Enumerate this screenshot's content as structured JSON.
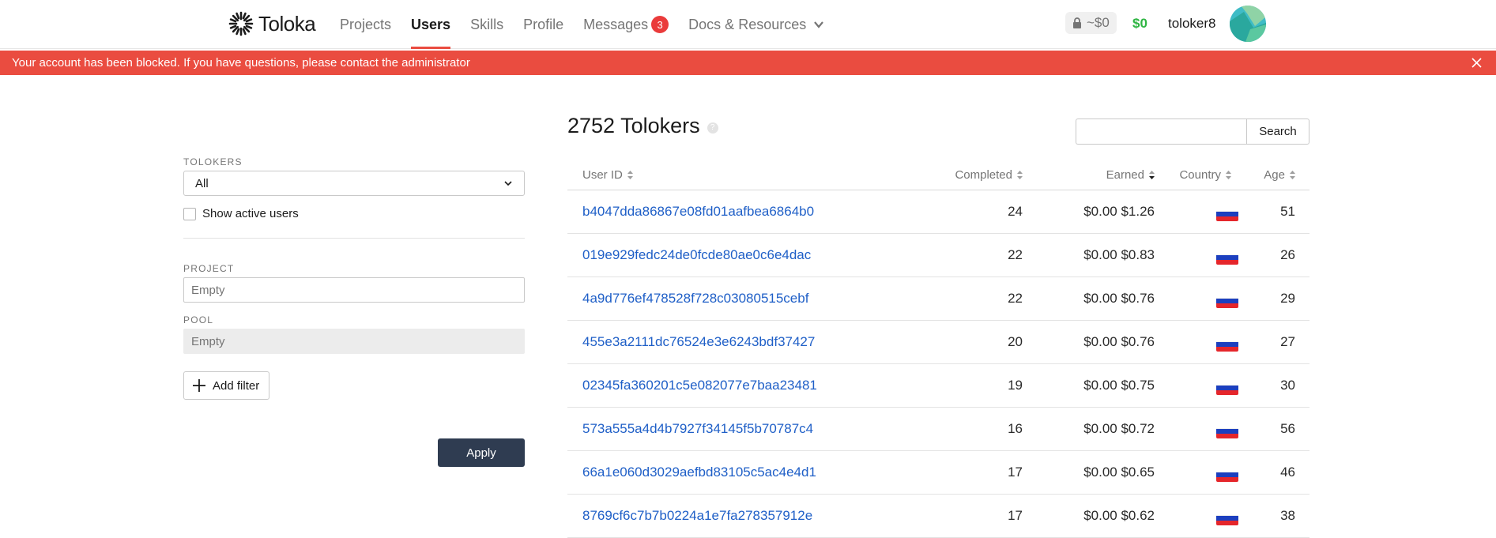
{
  "header": {
    "logo_text": "Toloka",
    "nav": [
      {
        "label": "Projects",
        "active": false
      },
      {
        "label": "Users",
        "active": true
      },
      {
        "label": "Skills",
        "active": false
      },
      {
        "label": "Profile",
        "active": false
      },
      {
        "label": "Messages",
        "active": false,
        "badge": "3"
      },
      {
        "label": "Docs & Resources",
        "active": false
      }
    ],
    "on_hold": "~$0",
    "balance": "$0",
    "username": "toloker8",
    "accent_color": "#ea4c40"
  },
  "alert": {
    "text": "Your account has been blocked. If you have questions, please contact the administrator",
    "color": "#ea4c40"
  },
  "filters": {
    "tolokers_label": "TOLOKERS",
    "tolokers_value": "All",
    "show_active_label": "Show active users",
    "project_label": "PROJECT",
    "project_placeholder": "Empty",
    "pool_label": "POOL",
    "pool_placeholder": "Empty",
    "add_filter_label": "Add filter",
    "apply_label": "Apply"
  },
  "main": {
    "title": "2752 Tolokers",
    "search_label": "Search",
    "columns": {
      "user_id": "User ID",
      "completed": "Completed",
      "earned": "Earned",
      "country": "Country",
      "age": "Age"
    },
    "rows": [
      {
        "user_id": "b4047dda86867e08fd01aafbea6864b0",
        "completed": "24",
        "earned": "$0.00 $1.26",
        "country": "ru-flag",
        "age": "51"
      },
      {
        "user_id": "019e929fedc24de0fcde80ae0c6e4dac",
        "completed": "22",
        "earned": "$0.00 $0.83",
        "country": "ru-flag",
        "age": "26"
      },
      {
        "user_id": "4a9d776ef478528f728c03080515cebf",
        "completed": "22",
        "earned": "$0.00 $0.76",
        "country": "ru-flag",
        "age": "29"
      },
      {
        "user_id": "455e3a2111dc76524e3e6243bdf37427",
        "completed": "20",
        "earned": "$0.00 $0.76",
        "country": "ru-flag",
        "age": "27"
      },
      {
        "user_id": "02345fa360201c5e082077e7baa23481",
        "completed": "19",
        "earned": "$0.00 $0.75",
        "country": "ru-flag",
        "age": "30"
      },
      {
        "user_id": "573a555a4d4b7927f34145f5b70787c4",
        "completed": "16",
        "earned": "$0.00 $0.72",
        "country": "ru-flag",
        "age": "56"
      },
      {
        "user_id": "66a1e060d3029aefbd83105c5ac4e4d1",
        "completed": "17",
        "earned": "$0.00 $0.65",
        "country": "ru-flag",
        "age": "46"
      },
      {
        "user_id": "8769cf6c7b7b0224a1e7fa278357912e",
        "completed": "17",
        "earned": "$0.00 $0.62",
        "country": "ru-flag",
        "age": "38"
      }
    ]
  }
}
